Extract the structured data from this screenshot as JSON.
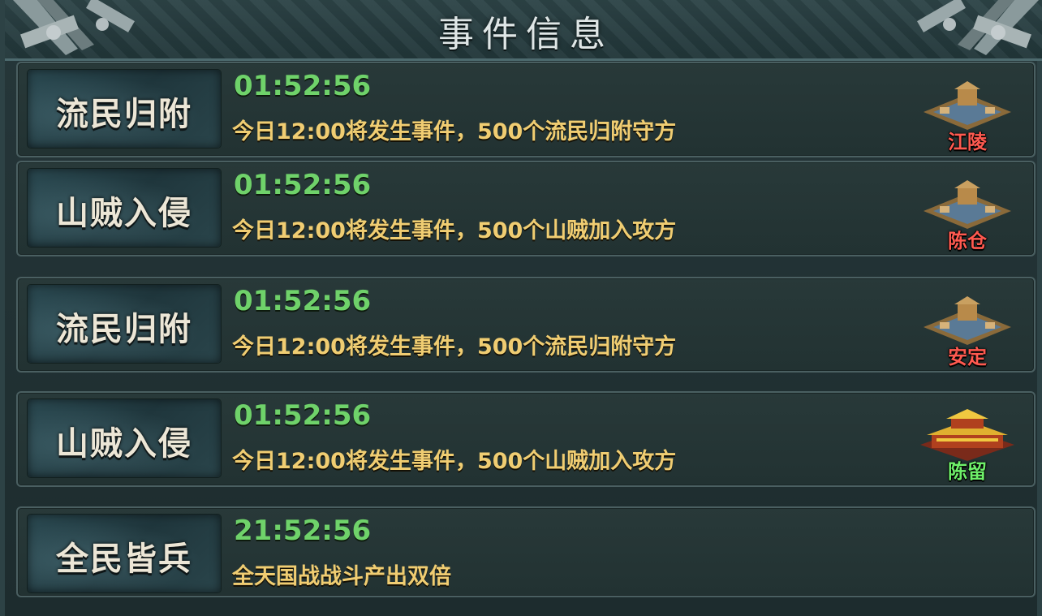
{
  "header": {
    "title": "事件信息"
  },
  "events": [
    {
      "tag": "流民归附",
      "time": "01:52:56",
      "desc": "今日12:00将发生事件，500个流民归附守方",
      "city": "江陵",
      "city_color": "#ff5a50"
    },
    {
      "tag": "山贼入侵",
      "time": "01:52:56",
      "desc": "今日12:00将发生事件，500个山贼加入攻方",
      "city": "陈仓",
      "city_color": "#ff5a50"
    },
    {
      "tag": "流民归附",
      "time": "01:52:56",
      "desc": "今日12:00将发生事件，500个流民归附守方",
      "city": "安定",
      "city_color": "#ff5a50"
    },
    {
      "tag": "山贼入侵",
      "time": "01:52:56",
      "desc": "今日12:00将发生事件，500个山贼加入攻方",
      "city": "陈留",
      "city_color": "#6ef06a"
    },
    {
      "tag": "全民皆兵",
      "time": "21:52:56",
      "desc": "全天国战战斗产出双倍"
    }
  ],
  "colors": {
    "timer": "#6fd26a",
    "description": "#f0cd72",
    "enemy_city": "#ff5a50",
    "own_city": "#6ef06a"
  }
}
